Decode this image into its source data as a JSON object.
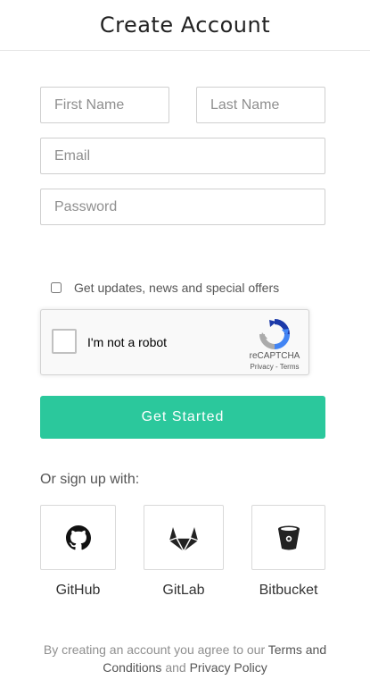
{
  "header": {
    "title": "Create Account"
  },
  "form": {
    "first_name": {
      "placeholder": "First Name",
      "value": ""
    },
    "last_name": {
      "placeholder": "Last Name",
      "value": ""
    },
    "email": {
      "placeholder": "Email",
      "value": ""
    },
    "password": {
      "placeholder": "Password",
      "value": ""
    },
    "updates_label": "Get updates, news and special offers",
    "updates_checked": false
  },
  "captcha": {
    "label": "I'm not a robot",
    "brand": "reCAPTCHA",
    "privacy": "Privacy",
    "separator": " - ",
    "terms": "Terms"
  },
  "submit": {
    "label": "Get Started"
  },
  "social": {
    "heading": "Or sign up with:",
    "providers": [
      {
        "label": "GitHub",
        "icon": "github-icon"
      },
      {
        "label": "GitLab",
        "icon": "gitlab-icon"
      },
      {
        "label": "Bitbucket",
        "icon": "bitbucket-icon"
      }
    ]
  },
  "legal": {
    "prefix": "By creating an account you agree to our ",
    "terms_link": "Terms and Conditions",
    "conjunction": " and ",
    "privacy_link": "Privacy Policy"
  },
  "colors": {
    "accent": "#2bc89c",
    "border": "#cfcfcf",
    "muted_text": "#8f8f8f"
  }
}
